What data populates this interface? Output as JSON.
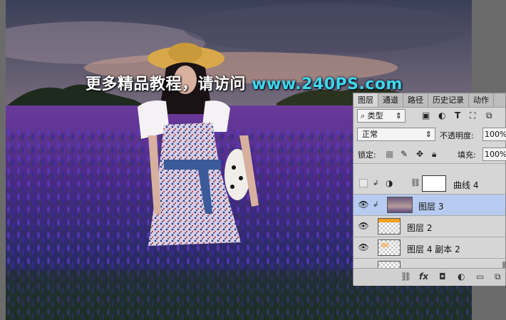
{
  "banner": {
    "cn": "更多精品教程，请访问 ",
    "url": "www.240PS.com"
  },
  "layers_panel": {
    "tabs": [
      {
        "label": "图层"
      },
      {
        "label": "通道"
      },
      {
        "label": "路径"
      },
      {
        "label": "历史记录"
      },
      {
        "label": "动作"
      }
    ],
    "filter_kind": "类型",
    "blend_mode": "正常",
    "opacity_label": "不透明度:",
    "opacity_value": "100%",
    "lock_label": "锁定:",
    "fill_label": "填充:",
    "fill_value": "100%",
    "layers": [
      {
        "name": "曲线 4",
        "visible": false,
        "selected": false
      },
      {
        "name": "图层 3",
        "visible": true,
        "selected": true
      },
      {
        "name": "图层 2",
        "visible": true,
        "selected": false
      },
      {
        "name": "图层 4 副本 2",
        "visible": true,
        "selected": false
      }
    ]
  },
  "colors": {
    "banner_url": "#3fd8e6",
    "selection": "#b7cbf0",
    "panel_bg": "#d6d6d6"
  },
  "icons": [
    "search-icon",
    "image-filter-icon",
    "adjust-filter-icon",
    "text-filter-icon",
    "shape-filter-icon",
    "smart-filter-icon",
    "eye-icon",
    "curves-icon",
    "link-icon",
    "clip-arrow-icon",
    "lock-pixels-icon",
    "brush-icon",
    "move-icon",
    "lock-all-icon",
    "fx-icon",
    "mask-icon",
    "new-adjust-icon",
    "folder-icon",
    "new-layer-icon"
  ]
}
